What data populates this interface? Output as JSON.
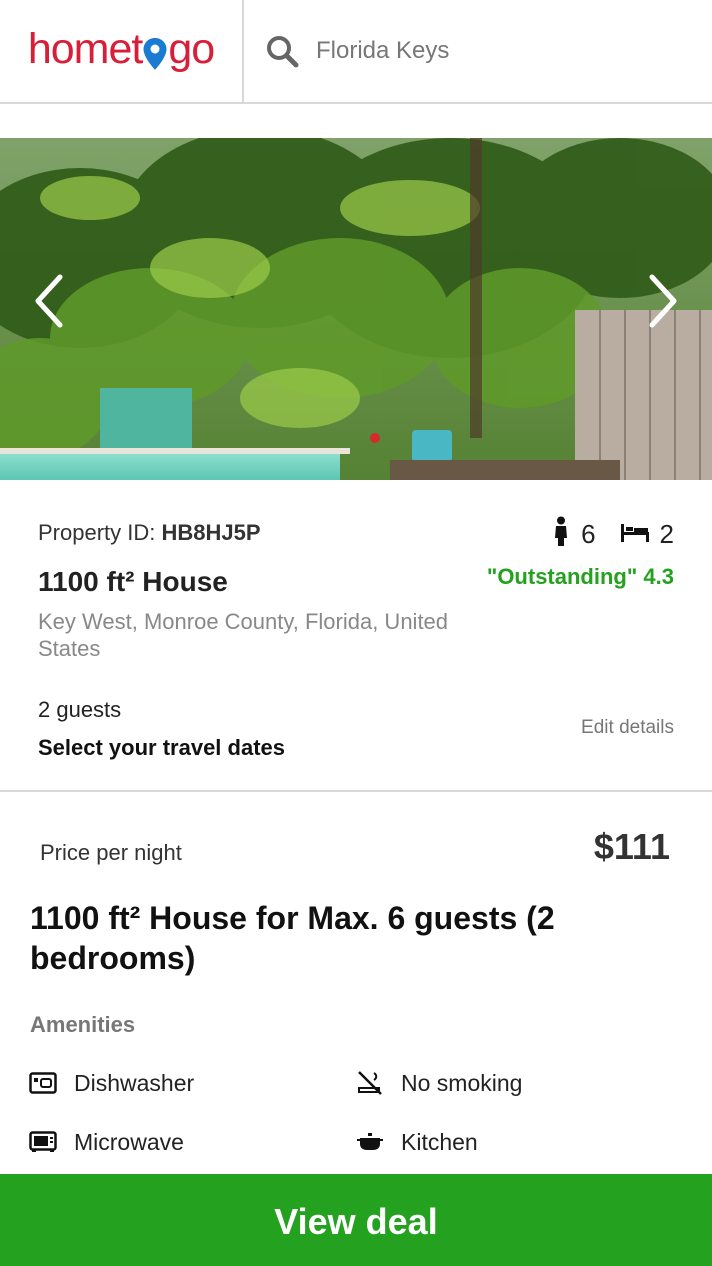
{
  "header": {
    "logo_text": "hometogo",
    "search": {
      "value": "Florida Keys",
      "icon": "search-icon"
    }
  },
  "gallery": {
    "prev_icon": "chevron-left-icon",
    "next_icon": "chevron-right-icon"
  },
  "property": {
    "id_label": "Property ID:",
    "id_value": "HB8HJ5P",
    "guests_capacity": "6",
    "bedrooms": "2",
    "title": "1100 ft² House",
    "rating": "\"Outstanding\" 4.3",
    "location": "Key West, Monroe County, Florida, United States",
    "guests": "2 guests",
    "dates_prompt": "Select your travel dates",
    "edit_label": "Edit details"
  },
  "pricing": {
    "label": "Price per night",
    "value": "$111"
  },
  "listing": {
    "title": "1100 ft² House for Max. 6 guests (2 bedrooms)"
  },
  "amenities": {
    "heading": "Amenities",
    "items": [
      {
        "label": "Dishwasher",
        "icon": "dishwasher-icon"
      },
      {
        "label": "No smoking",
        "icon": "no-smoking-icon"
      },
      {
        "label": "Microwave",
        "icon": "microwave-icon"
      },
      {
        "label": "Kitchen",
        "icon": "kitchen-icon"
      }
    ]
  },
  "cta": {
    "label": "View deal"
  },
  "colors": {
    "brand_red": "#d71f3a",
    "brand_blue": "#1a7bd3",
    "accent_green": "#23a11f"
  }
}
